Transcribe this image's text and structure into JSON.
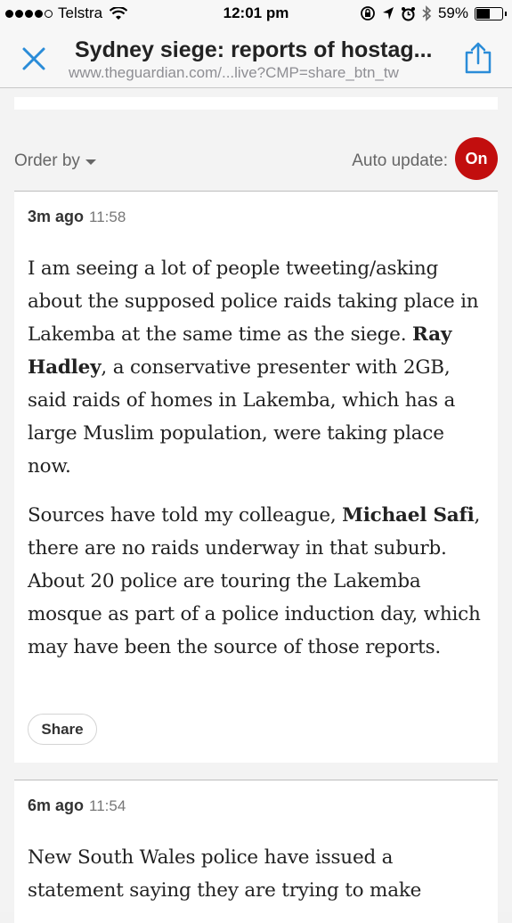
{
  "status": {
    "carrier": "Telstra",
    "time": "12:01 pm",
    "battery": "59%",
    "battery_level": 0.59
  },
  "nav": {
    "title": "Sydney siege: reports of hostag...",
    "url": "www.theguardian.com/...live?CMP=share_btn_tw",
    "close_icon": "close-icon",
    "share_icon": "share-icon"
  },
  "controls": {
    "order_by": "Order by",
    "auto_update": "Auto update:",
    "auto_update_state": "On"
  },
  "colors": {
    "accent": "#c20e0e",
    "ios_blue": "#2a8cd8"
  },
  "posts": [
    {
      "ago": "3m ago",
      "time": "11:58",
      "p1_a": "I am seeing a lot of people tweeting/asking about the supposed police raids taking place in Lakemba at the same time as the siege. ",
      "p1_b": "Ray Hadley",
      "p1_c": ", a conservative presenter with 2GB, said raids of homes in Lakemba, which has a large Muslim population, were taking place now.",
      "p2_a": "Sources have told my colleague, ",
      "p2_b": "Michael Safi",
      "p2_c": ", there are no raids underway in that suburb. About 20 police are touring the Lakemba mosque as part of a police induction day, which may have been the source of those reports.",
      "share": "Share"
    },
    {
      "ago": "6m ago",
      "time": "11:54",
      "p1": "New South Wales police have issued a statement saying they are trying to make"
    }
  ]
}
